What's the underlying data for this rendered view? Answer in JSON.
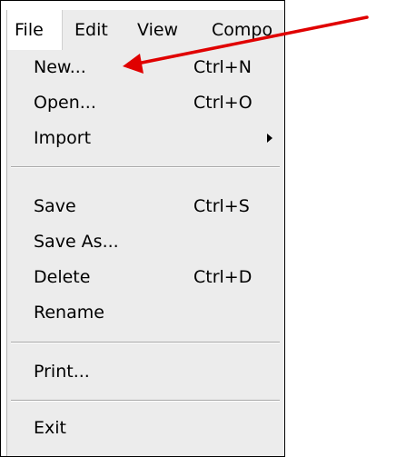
{
  "menubar": {
    "items": [
      {
        "label": "File"
      },
      {
        "label": "Edit"
      },
      {
        "label": "View"
      },
      {
        "label": "Compo"
      }
    ]
  },
  "file_menu": {
    "items": [
      {
        "label": "New...",
        "shortcut": "Ctrl+N"
      },
      {
        "label": "Open...",
        "shortcut": "Ctrl+O"
      },
      {
        "label": "Import",
        "submenu": true
      },
      {
        "label": "Save",
        "shortcut": "Ctrl+S"
      },
      {
        "label": "Save As..."
      },
      {
        "label": "Delete",
        "shortcut": "Ctrl+D"
      },
      {
        "label": "Rename"
      },
      {
        "label": "Print..."
      },
      {
        "label": "Exit"
      }
    ]
  },
  "colors": {
    "annotation_arrow": "#e00000",
    "menu_background": "#ececec",
    "separator": "#a8a8a8"
  },
  "icons": {
    "submenu_arrow": "triangle-right",
    "annotation": "red-arrow"
  }
}
